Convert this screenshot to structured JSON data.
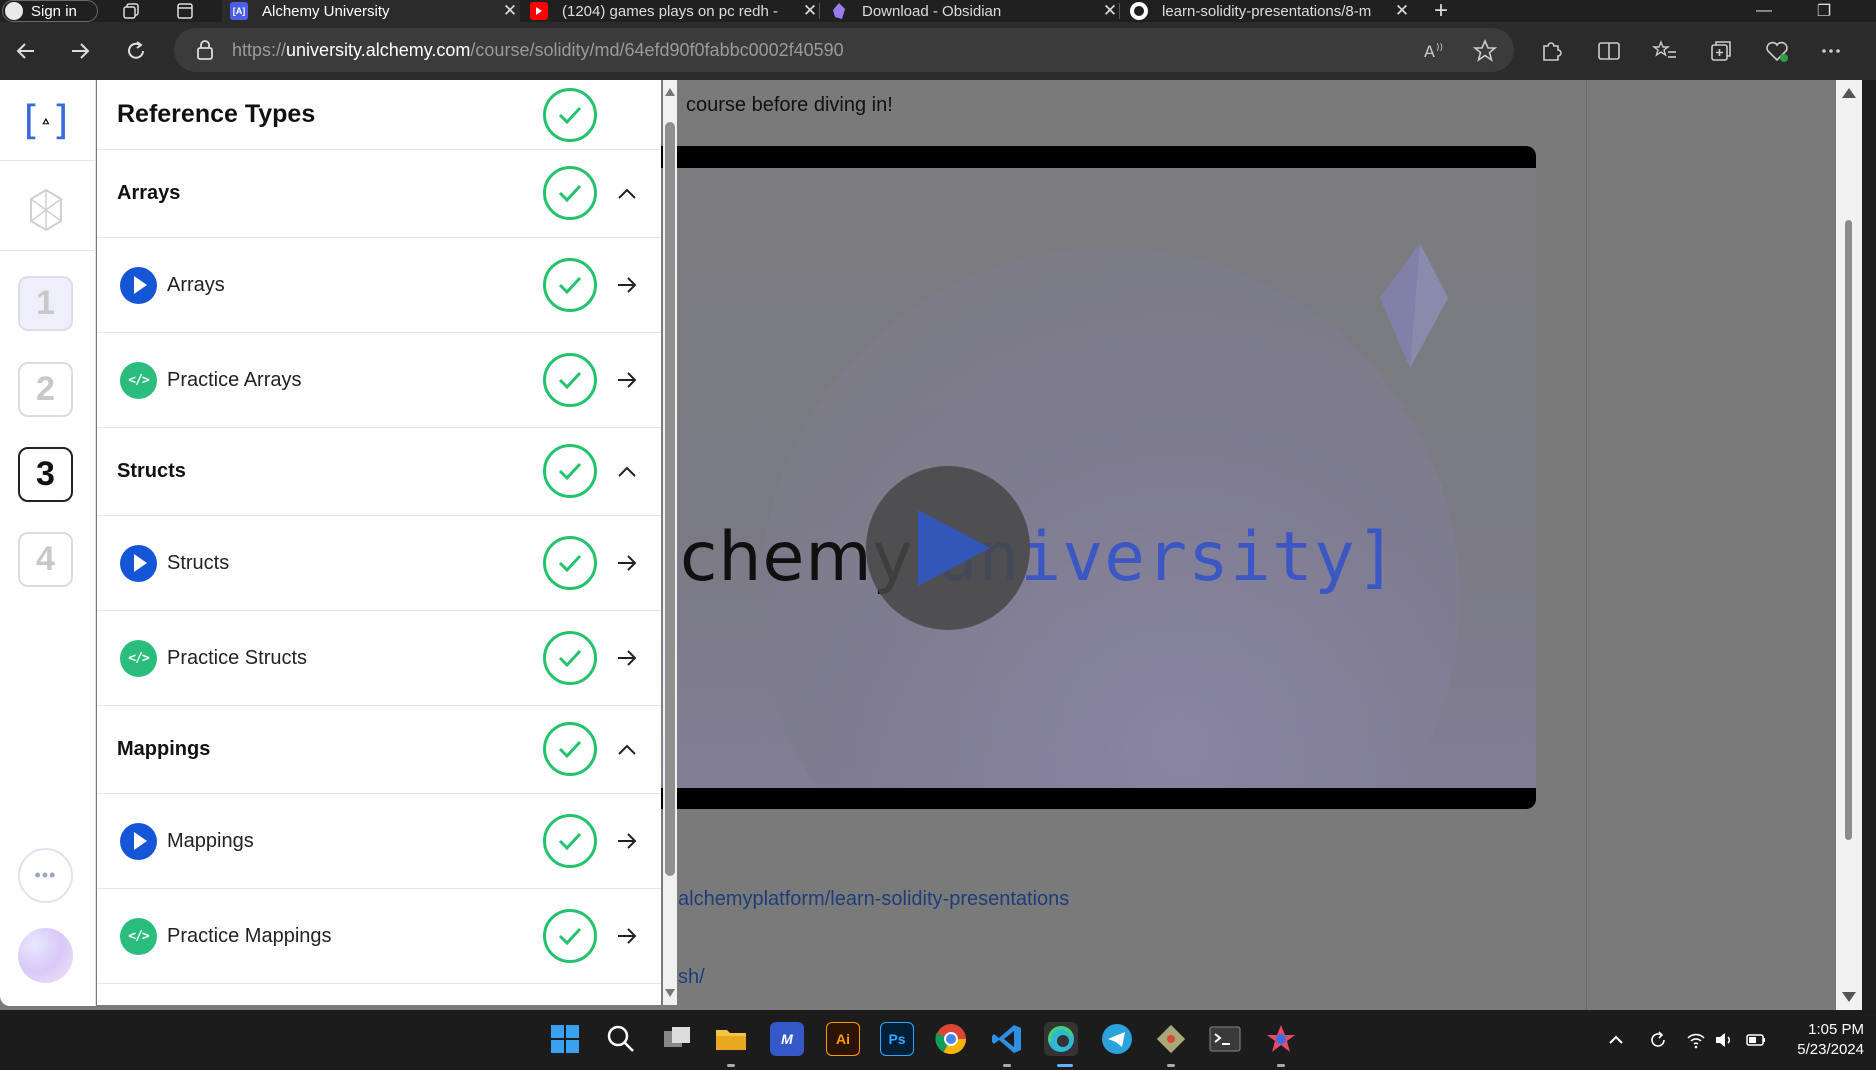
{
  "browser": {
    "signin_label": "Sign in",
    "tabs": [
      {
        "title": "Alchemy University",
        "favicon": "alchemy-icon",
        "active": true
      },
      {
        "title": "(1204) games plays on pc redh -",
        "favicon": "youtube-icon",
        "active": false
      },
      {
        "title": "Download - Obsidian",
        "favicon": "obsidian-icon",
        "active": false
      },
      {
        "title": "learn-solidity-presentations/8-m",
        "favicon": "github-icon",
        "active": false
      }
    ],
    "url_scheme": "https://",
    "url_host": "university.alchemy.com",
    "url_path": "/course/solidity/md/64efd90f0fabbc0002f40590"
  },
  "rail": {
    "steps": [
      "1",
      "2",
      "3",
      "4"
    ],
    "current_step": "3",
    "more_label": "•••"
  },
  "panel": {
    "header": "Reference Types",
    "rows": [
      {
        "kind": "section",
        "title": "Arrays"
      },
      {
        "kind": "video",
        "label": "Arrays"
      },
      {
        "kind": "code",
        "label": "Practice Arrays"
      },
      {
        "kind": "section",
        "title": "Structs"
      },
      {
        "kind": "video",
        "label": "Structs"
      },
      {
        "kind": "code",
        "label": "Practice Structs"
      },
      {
        "kind": "section",
        "title": "Mappings"
      },
      {
        "kind": "video",
        "label": "Mappings"
      },
      {
        "kind": "code",
        "label": "Practice Mappings"
      }
    ],
    "code_badge": "</>"
  },
  "content": {
    "intro_fragment": "course before diving in!",
    "video_brand_a": "chemy ",
    "video_brand_b": "university]",
    "link1_fragment": "alchemyplatform/learn-solidity-presentations",
    "link2_fragment": "sh/"
  },
  "taskbar": {
    "time": "1:05 PM",
    "date": "5/23/2024",
    "apps": [
      "windows-start-icon",
      "search-icon",
      "task-view-icon",
      "file-explorer-icon",
      "app-m-icon",
      "illustrator-icon",
      "photoshop-icon",
      "chrome-icon",
      "vscode-icon",
      "edge-icon",
      "telegram-icon",
      "git-icon",
      "terminal-icon",
      "app-star-icon"
    ],
    "ai_label": "Ai",
    "ps_label": "Ps"
  },
  "colors": {
    "accent_blue": "#1556d6",
    "complete_green": "#22c36c",
    "code_green": "#2bbd7e"
  }
}
